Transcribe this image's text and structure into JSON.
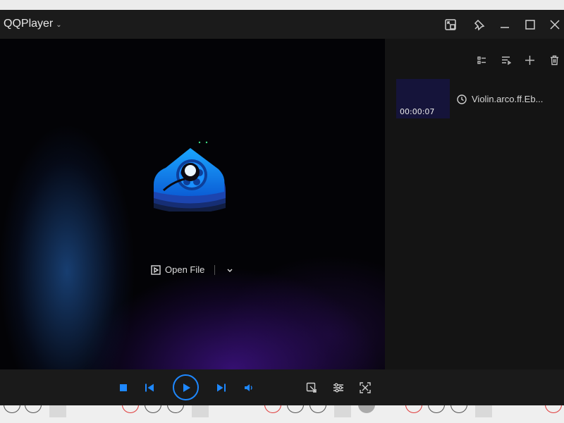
{
  "window": {
    "title": "QQPlayer"
  },
  "player": {
    "open_file_label": "Open File"
  },
  "playlist": {
    "items": [
      {
        "duration": "00:00:07",
        "name": "Violin.arco.ff.Eb..."
      }
    ]
  },
  "colors": {
    "accent": "#1e88ff",
    "titlebar_bg": "#1b1b1b",
    "panel_bg": "#141414",
    "controls_bg": "#1a1a1a"
  },
  "icons": {
    "titlebar": [
      "mini-mode-icon",
      "pin-icon",
      "minimize-icon",
      "maximize-icon",
      "close-icon"
    ],
    "panel": [
      "list-view-icon",
      "play-mode-icon",
      "add-icon",
      "delete-icon"
    ],
    "controls": [
      "stop-icon",
      "previous-icon",
      "play-icon",
      "next-icon",
      "volume-icon",
      "tools-icon",
      "settings-icon",
      "fullscreen-icon"
    ]
  }
}
